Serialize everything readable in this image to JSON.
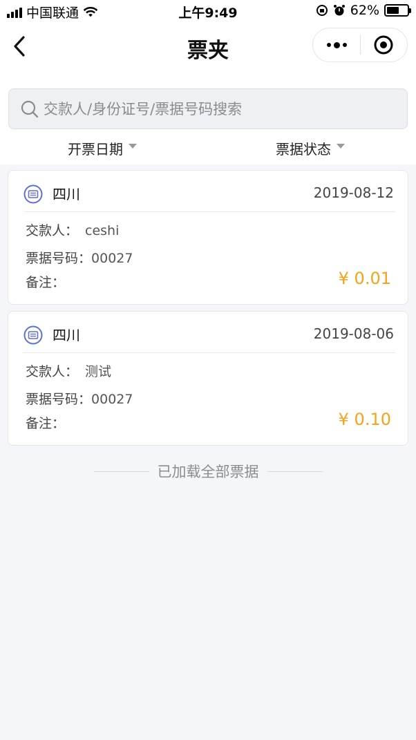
{
  "status_bar": {
    "carrier": "中国联通",
    "time": "上午9:49",
    "battery": "62%",
    "battery_level": 0.62
  },
  "nav": {
    "title": "票夹",
    "back_icon": "chevron-left-icon",
    "more_icon": "more-dots-icon",
    "close_icon": "target-close-icon"
  },
  "search": {
    "placeholder": "交款人/身份证号/票据号码搜索",
    "value": ""
  },
  "filters": [
    {
      "label": "开票日期"
    },
    {
      "label": "票据状态"
    }
  ],
  "receipts": [
    {
      "payee": "四川",
      "date": "2019-08-12",
      "payer_label": "交款人：",
      "payer": "ceshi",
      "number_label": "票据号码：",
      "number": "00027",
      "note_label": "备注：",
      "note": "",
      "amount": "¥ 0.01"
    },
    {
      "payee": "四川",
      "date": "2019-08-06",
      "payer_label": "交款人：",
      "payer": "测试",
      "number_label": "票据号码：",
      "number": "00027",
      "note_label": "备注：",
      "note": "",
      "amount": "¥ 0.10"
    }
  ],
  "footer": {
    "text": "已加载全部票据"
  },
  "colors": {
    "accent": "#5b6fd6",
    "amount": "#f5a31b",
    "background": "#f5f6fa"
  }
}
